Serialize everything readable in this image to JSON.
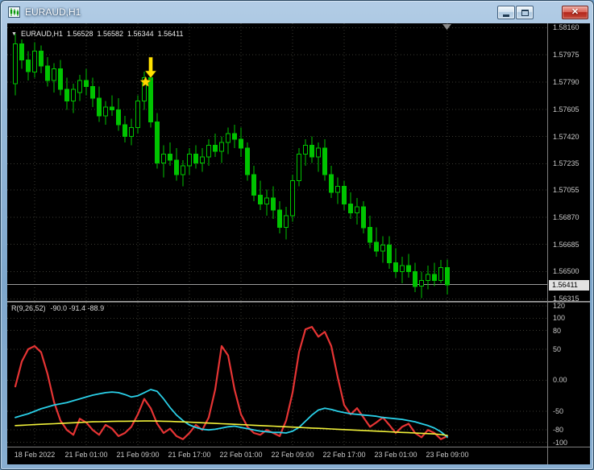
{
  "window": {
    "title": "EURAUD,H1",
    "controls": {
      "minimize_icon": "minimize-bar",
      "maximize_icon": "maximize-square",
      "close_icon": "close-x",
      "close_glyph": "✕",
      "titlebar_icon": "candlestick-chart-icon"
    }
  },
  "main_chart_header": {
    "collapse_arrow": "▼",
    "symbol_period": "EURAUD,H1",
    "open": "1.56528",
    "high": "1.56582",
    "low": "1.56344",
    "close": "1.56411"
  },
  "indicator_header": {
    "name": "R(9,26,52)",
    "values": "-90.0 -91.4 -88.9"
  },
  "price_axis": {
    "labels": [
      "1.58160",
      "1.57975",
      "1.57790",
      "1.57605",
      "1.57420",
      "1.57235",
      "1.57055",
      "1.56870",
      "1.56685",
      "1.56500",
      "1.56315"
    ],
    "bid": "1.56411"
  },
  "indicator_axis": {
    "labels": [
      "120",
      "100",
      "80",
      "50",
      "0.00",
      "-50",
      "-80",
      "-100"
    ],
    "values": [
      120,
      100,
      80,
      50,
      0,
      -50,
      -80,
      -100
    ]
  },
  "time_axis": {
    "labels": [
      "18 Feb 2022",
      "21 Feb 01:00",
      "21 Feb 09:00",
      "21 Feb 17:00",
      "22 Feb 01:00",
      "22 Feb 09:00",
      "22 Feb 17:00",
      "23 Feb 01:00",
      "23 Feb 09:00"
    ]
  },
  "annotations": [
    {
      "name": "yellow-down-arrow",
      "type": "arrow-down",
      "candle_index": 21,
      "price": 1.5796,
      "color": "#ffe100"
    },
    {
      "name": "yellow-star",
      "type": "star",
      "candle_index": 20.2,
      "price": 1.5779,
      "color": "#ffd700"
    }
  ],
  "colors": {
    "background": "#000000",
    "grid": "#3a3a32",
    "candle": "#00c400",
    "bull_fill": "#000000",
    "bear_fill": "#00c400",
    "bid_line": "#9a9a9a",
    "axis_text": "#c8c8c8",
    "indicator_red": "#e63434",
    "indicator_cyan": "#2ad0e8",
    "indicator_yellow": "#f2f23a"
  },
  "chart_data": [
    {
      "type": "candlestick",
      "title": "EURAUD,H1",
      "ylabel": "price",
      "ylim": [
        1.563,
        1.5819
      ],
      "price_gridlines": [
        1.5816,
        1.57975,
        1.5779,
        1.57605,
        1.5742,
        1.57235,
        1.57055,
        1.5687,
        1.56685,
        1.565,
        1.56315
      ],
      "bid": 1.56411,
      "x_gridline_indices": [
        3,
        11,
        19,
        27,
        35,
        43,
        51,
        59,
        67
      ],
      "x_gridline_labels": [
        "18 Feb 2022",
        "21 Feb 01:00",
        "21 Feb 09:00",
        "21 Feb 17:00",
        "22 Feb 01:00",
        "22 Feb 09:00",
        "22 Feb 17:00",
        "23 Feb 01:00",
        "23 Feb 09:00"
      ],
      "candles": [
        [
          1.5778,
          1.5812,
          1.577,
          1.5805
        ],
        [
          1.5805,
          1.5808,
          1.5788,
          1.5794
        ],
        [
          1.5794,
          1.58,
          1.578,
          1.5786
        ],
        [
          1.5786,
          1.5806,
          1.5782,
          1.58
        ],
        [
          1.58,
          1.5804,
          1.5785,
          1.579
        ],
        [
          1.579,
          1.5796,
          1.5776,
          1.578
        ],
        [
          1.578,
          1.5792,
          1.5772,
          1.5788
        ],
        [
          1.5788,
          1.5794,
          1.577,
          1.5774
        ],
        [
          1.5774,
          1.5782,
          1.576,
          1.5766
        ],
        [
          1.5766,
          1.5778,
          1.5758,
          1.5774
        ],
        [
          1.5772,
          1.5784,
          1.5766,
          1.578
        ],
        [
          1.578,
          1.5788,
          1.577,
          1.5776
        ],
        [
          1.5776,
          1.5782,
          1.5762,
          1.5768
        ],
        [
          1.5768,
          1.5776,
          1.5752,
          1.5756
        ],
        [
          1.5756,
          1.5766,
          1.575,
          1.5762
        ],
        [
          1.5762,
          1.577,
          1.5756,
          1.576
        ],
        [
          1.576,
          1.5768,
          1.5746,
          1.575
        ],
        [
          1.575,
          1.5756,
          1.5738,
          1.5742
        ],
        [
          1.5742,
          1.5754,
          1.5736,
          1.5748
        ],
        [
          1.5748,
          1.577,
          1.5744,
          1.5766
        ],
        [
          1.5766,
          1.5786,
          1.576,
          1.5782
        ],
        [
          1.5782,
          1.5784,
          1.5748,
          1.5752
        ],
        [
          1.5752,
          1.5758,
          1.572,
          1.5724
        ],
        [
          1.5724,
          1.5736,
          1.5714,
          1.573
        ],
        [
          1.573,
          1.5738,
          1.5722,
          1.5726
        ],
        [
          1.5726,
          1.5734,
          1.5712,
          1.5716
        ],
        [
          1.5716,
          1.5726,
          1.5708,
          1.5722
        ],
        [
          1.5722,
          1.5734,
          1.5716,
          1.573
        ],
        [
          1.573,
          1.5736,
          1.572,
          1.5724
        ],
        [
          1.5724,
          1.5734,
          1.5718,
          1.5728
        ],
        [
          1.5728,
          1.574,
          1.5722,
          1.5736
        ],
        [
          1.5736,
          1.5744,
          1.5728,
          1.5732
        ],
        [
          1.5732,
          1.5742,
          1.5724,
          1.5738
        ],
        [
          1.5738,
          1.5748,
          1.573,
          1.5744
        ],
        [
          1.5744,
          1.575,
          1.5734,
          1.574
        ],
        [
          1.574,
          1.5748,
          1.5728,
          1.5734
        ],
        [
          1.5734,
          1.5738,
          1.5712,
          1.5716
        ],
        [
          1.5716,
          1.5722,
          1.5698,
          1.5702
        ],
        [
          1.5702,
          1.5712,
          1.5692,
          1.5696
        ],
        [
          1.5696,
          1.5706,
          1.5688,
          1.57
        ],
        [
          1.57,
          1.5708,
          1.5686,
          1.5692
        ],
        [
          1.5692,
          1.5698,
          1.5676,
          1.568
        ],
        [
          1.568,
          1.5694,
          1.5672,
          1.5688
        ],
        [
          1.5688,
          1.5716,
          1.5684,
          1.5712
        ],
        [
          1.5712,
          1.5734,
          1.5708,
          1.573
        ],
        [
          1.573,
          1.574,
          1.5722,
          1.5736
        ],
        [
          1.5736,
          1.5742,
          1.5724,
          1.5728
        ],
        [
          1.5728,
          1.5738,
          1.5718,
          1.5734
        ],
        [
          1.5734,
          1.574,
          1.5712,
          1.5716
        ],
        [
          1.5716,
          1.5722,
          1.57,
          1.5704
        ],
        [
          1.5704,
          1.5714,
          1.5696,
          1.5708
        ],
        [
          1.5708,
          1.5712,
          1.5692,
          1.5696
        ],
        [
          1.5696,
          1.5704,
          1.5686,
          1.569
        ],
        [
          1.569,
          1.57,
          1.5682,
          1.5694
        ],
        [
          1.5694,
          1.5698,
          1.5676,
          1.568
        ],
        [
          1.568,
          1.5688,
          1.5666,
          1.567
        ],
        [
          1.567,
          1.568,
          1.566,
          1.5664
        ],
        [
          1.5664,
          1.5674,
          1.5656,
          1.5668
        ],
        [
          1.5668,
          1.5674,
          1.5652,
          1.5656
        ],
        [
          1.5656,
          1.5666,
          1.5646,
          1.565
        ],
        [
          1.565,
          1.566,
          1.5642,
          1.5654
        ],
        [
          1.5654,
          1.5662,
          1.5646,
          1.565
        ],
        [
          1.565,
          1.5656,
          1.5636,
          1.564
        ],
        [
          1.564,
          1.565,
          1.5632,
          1.5644
        ],
        [
          1.5644,
          1.5654,
          1.5638,
          1.5648
        ],
        [
          1.5648,
          1.5656,
          1.564,
          1.5644
        ],
        [
          1.5644,
          1.5658,
          1.5642,
          1.56528
        ],
        [
          1.56528,
          1.56582,
          1.56344,
          1.56411
        ]
      ]
    },
    {
      "type": "line",
      "title": "R(9,26,52)",
      "ylim": [
        -107,
        125
      ],
      "y_gridlines": [
        120,
        100,
        80,
        50,
        0,
        -50,
        -80,
        -100
      ],
      "current_values": [
        -90.0,
        -91.4,
        -88.9
      ],
      "series": [
        {
          "name": "fast",
          "color": "#e63434",
          "values": [
            -10,
            30,
            50,
            55,
            45,
            10,
            -35,
            -65,
            -80,
            -88,
            -62,
            -68,
            -80,
            -88,
            -72,
            -78,
            -90,
            -85,
            -75,
            -55,
            -30,
            -45,
            -70,
            -85,
            -78,
            -90,
            -95,
            -85,
            -72,
            -80,
            -60,
            -15,
            55,
            40,
            -15,
            -55,
            -75,
            -85,
            -88,
            -80,
            -85,
            -90,
            -65,
            -20,
            45,
            82,
            86,
            70,
            78,
            55,
            5,
            -40,
            -55,
            -45,
            -60,
            -75,
            -68,
            -60,
            -72,
            -85,
            -75,
            -70,
            -85,
            -92,
            -80,
            -85,
            -95,
            -90
          ]
        },
        {
          "name": "mid",
          "color": "#2ad0e8",
          "values": [
            -60,
            -57,
            -54,
            -50,
            -46,
            -43,
            -40,
            -38,
            -36,
            -33,
            -30,
            -27,
            -24,
            -22,
            -20,
            -19,
            -20,
            -23,
            -27,
            -25,
            -20,
            -15,
            -18,
            -30,
            -44,
            -56,
            -65,
            -72,
            -76,
            -79,
            -80,
            -79,
            -77,
            -75,
            -74,
            -76,
            -78,
            -80,
            -82,
            -83,
            -84,
            -84,
            -85,
            -82,
            -76,
            -66,
            -56,
            -48,
            -45,
            -47,
            -50,
            -52,
            -54,
            -55,
            -56,
            -57,
            -58,
            -60,
            -61,
            -62,
            -63,
            -65,
            -67,
            -70,
            -73,
            -77,
            -83,
            -91.4
          ]
        },
        {
          "name": "slow",
          "color": "#f2f23a",
          "values": [
            -73,
            -72.5,
            -72,
            -71.5,
            -71,
            -70.5,
            -70,
            -69.5,
            -69,
            -68.5,
            -68,
            -67.5,
            -67,
            -66.8,
            -66.5,
            -66.3,
            -66.1,
            -66,
            -65.9,
            -65.8,
            -65.7,
            -65.6,
            -65.8,
            -66,
            -66.3,
            -66.7,
            -67.1,
            -67.5,
            -68,
            -68.5,
            -69,
            -69.5,
            -70,
            -70.5,
            -71,
            -71.5,
            -72,
            -72.5,
            -73,
            -73.5,
            -74,
            -74.5,
            -75,
            -75.5,
            -76,
            -76.5,
            -77,
            -77.5,
            -78,
            -78.5,
            -79,
            -79.5,
            -80,
            -80.5,
            -81,
            -81.5,
            -82,
            -82.5,
            -83,
            -83.5,
            -84,
            -84.5,
            -85,
            -85.5,
            -86,
            -86.5,
            -87.5,
            -88.9
          ]
        }
      ]
    }
  ]
}
